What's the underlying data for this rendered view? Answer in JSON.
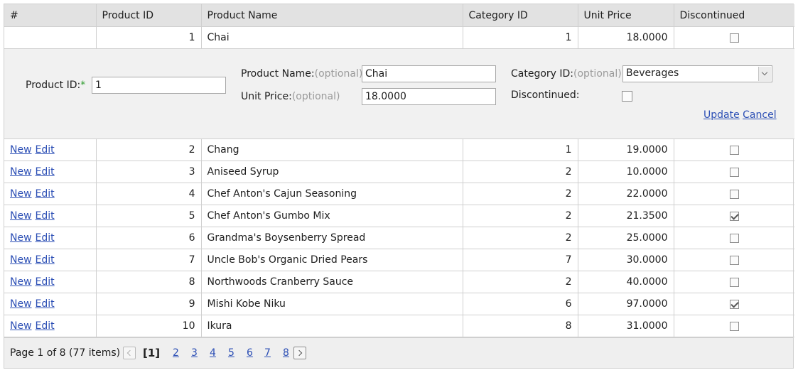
{
  "columns": [
    "#",
    "Product ID",
    "Product Name",
    "Category ID",
    "Unit Price",
    "Discontinued"
  ],
  "first_row": {
    "id": "1",
    "name": "Chai",
    "category": "1",
    "price": "18.0000",
    "discontinued": false
  },
  "edit_form": {
    "product_id_label": "Product ID:",
    "required_mark": "*",
    "product_id_value": "1",
    "product_name_label": "Product Name:",
    "unit_price_label": "Unit Price:",
    "category_id_label": "Category ID:",
    "discontinued_label": "Discontinued:",
    "optional_text": "(optional)",
    "product_name_value": "Chai",
    "unit_price_value": "18.0000",
    "category_value": "Beverages",
    "discontinued": false,
    "update_label": "Update",
    "cancel_label": "Cancel"
  },
  "command_labels": {
    "new": "New",
    "edit": "Edit"
  },
  "rows": [
    {
      "id": "2",
      "name": "Chang",
      "category": "1",
      "price": "19.0000",
      "discontinued": false
    },
    {
      "id": "3",
      "name": "Aniseed Syrup",
      "category": "2",
      "price": "10.0000",
      "discontinued": false
    },
    {
      "id": "4",
      "name": "Chef Anton's Cajun Seasoning",
      "category": "2",
      "price": "22.0000",
      "discontinued": false
    },
    {
      "id": "5",
      "name": "Chef Anton's Gumbo Mix",
      "category": "2",
      "price": "21.3500",
      "discontinued": true
    },
    {
      "id": "6",
      "name": "Grandma's Boysenberry Spread",
      "category": "2",
      "price": "25.0000",
      "discontinued": false
    },
    {
      "id": "7",
      "name": "Uncle Bob's Organic Dried Pears",
      "category": "7",
      "price": "30.0000",
      "discontinued": false
    },
    {
      "id": "8",
      "name": "Northwoods Cranberry Sauce",
      "category": "2",
      "price": "40.0000",
      "discontinued": false
    },
    {
      "id": "9",
      "name": "Mishi Kobe Niku",
      "category": "6",
      "price": "97.0000",
      "discontinued": true
    },
    {
      "id": "10",
      "name": "Ikura",
      "category": "8",
      "price": "31.0000",
      "discontinued": false
    }
  ],
  "pager": {
    "summary": "Page 1 of 8 (77 items)",
    "current": "[1]",
    "pages": [
      "2",
      "3",
      "4",
      "5",
      "6",
      "7",
      "8"
    ]
  },
  "icons": {
    "prev": "chevron-left-icon",
    "next": "chevron-right-icon",
    "dropdown": "chevron-down-icon"
  }
}
